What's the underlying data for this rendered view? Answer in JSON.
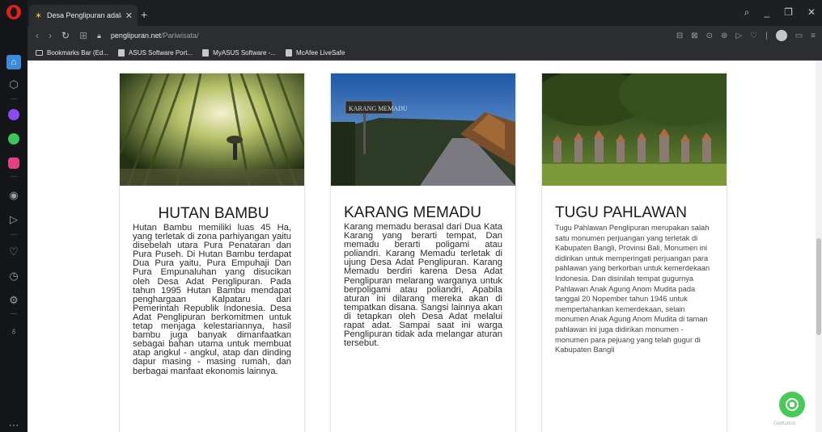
{
  "browser": {
    "tab_title": "Desa Penglipuran adalah d",
    "tab_close": "✕",
    "new_tab": "+",
    "url_domain": "penglipuran.net",
    "url_path": "/Pariwisata/",
    "bookmarks": [
      "Bookmarks Bar (Ed...",
      "ASUS Software Port...",
      "MyASUS Software -...",
      "McAfee LiveSafe"
    ]
  },
  "cards": [
    {
      "title": "HUTAN BAMBU",
      "body": "Hutan Bambu memiliki luas 45 Ha, yang terletak di zona parhiyangan yaitu disebelah utara Pura Penataran dan Pura Puseh. Di Hutan Bambu terdapat Dua Pura yaitu, Pura Empuhaji Dan Pura Empunaluhan yang disucikan oleh Desa Adat Penglipuran. Pada tahun 1995 Hutan Bambu mendapat penghargaan Kalpataru dari Pemerintah Republik Indonesia. Desa Adat Penglipuran berkomitmen untuk tetap menjaga kelestariannya, hasil bambu juga banyak dimanfaatkan sebagai bahan utama untuk membuat atap angkul - angkul, atap dan dinding dapur masing - masing rumah, dan berbagai manfaat ekonomis lainnya."
    },
    {
      "title": "KARANG MEMADU",
      "sign": "KARANG MEMADU",
      "body": "Karang memadu berasal dari Dua Kata Karang yang berarti tempat, Dan memadu berarti poligami atau poliandri. Karang Memadu terletak di ujung Desa Adat Penglipuran. Karang Memadu berdiri karena Desa Adat Penglipuran melarang warganya untuk berpoligami atau poliandri, Apabila aturan ini dilarang mereka akan di tempatkan disana. Sangsi lainnya akan di tetapkan oleh Desa Adat melalui rapat adat. Sampai saat ini warga Penglipuran tidak ada melangar aturan tersebut."
    },
    {
      "title": "TUGU PAHLAWAN",
      "body": "Tugu Pahlawan Penglipuran merupakan salah satu monumen perjuangan yang terletak di Kabupaten Bangli, Provinsi Bali, Monumen ini didirikan untuk memperingati perjuangan para pahlawan yang berkorban untuk kemerdekaan Indonesia. Dan disinilah tempat gugurnya Pahlawan Anak Agung Anom Mudita pada tanggal 20 Nopember tahun 1946 untuk mempertahankan kemerdekaan, selain monumen Anak Agung Anom Mudita di taman pahlawan ini juga didirikan monumen - monumen para pejuang yang telah gugur di Kabupaten Bangli"
    }
  ],
  "getbutton_label": "GetButton"
}
